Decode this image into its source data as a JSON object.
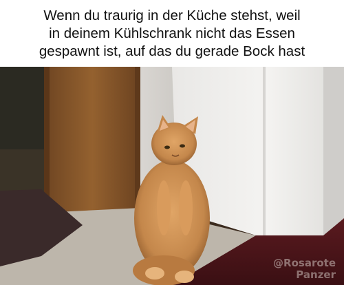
{
  "caption": {
    "lines": [
      "Wenn du traurig in der Küche stehst, weil",
      "in deinem Kühlschrank nicht das Essen",
      "gespawnt ist, auf das du gerade Bock hast"
    ]
  },
  "watermark": {
    "line1": "@Rosarote",
    "line2": "Panzer"
  },
  "colors": {
    "cat_fur": "#c98a4e",
    "fridge": "#f2f1ef",
    "carpet": "#4a1418",
    "door_wood": "#8a5a2e"
  }
}
